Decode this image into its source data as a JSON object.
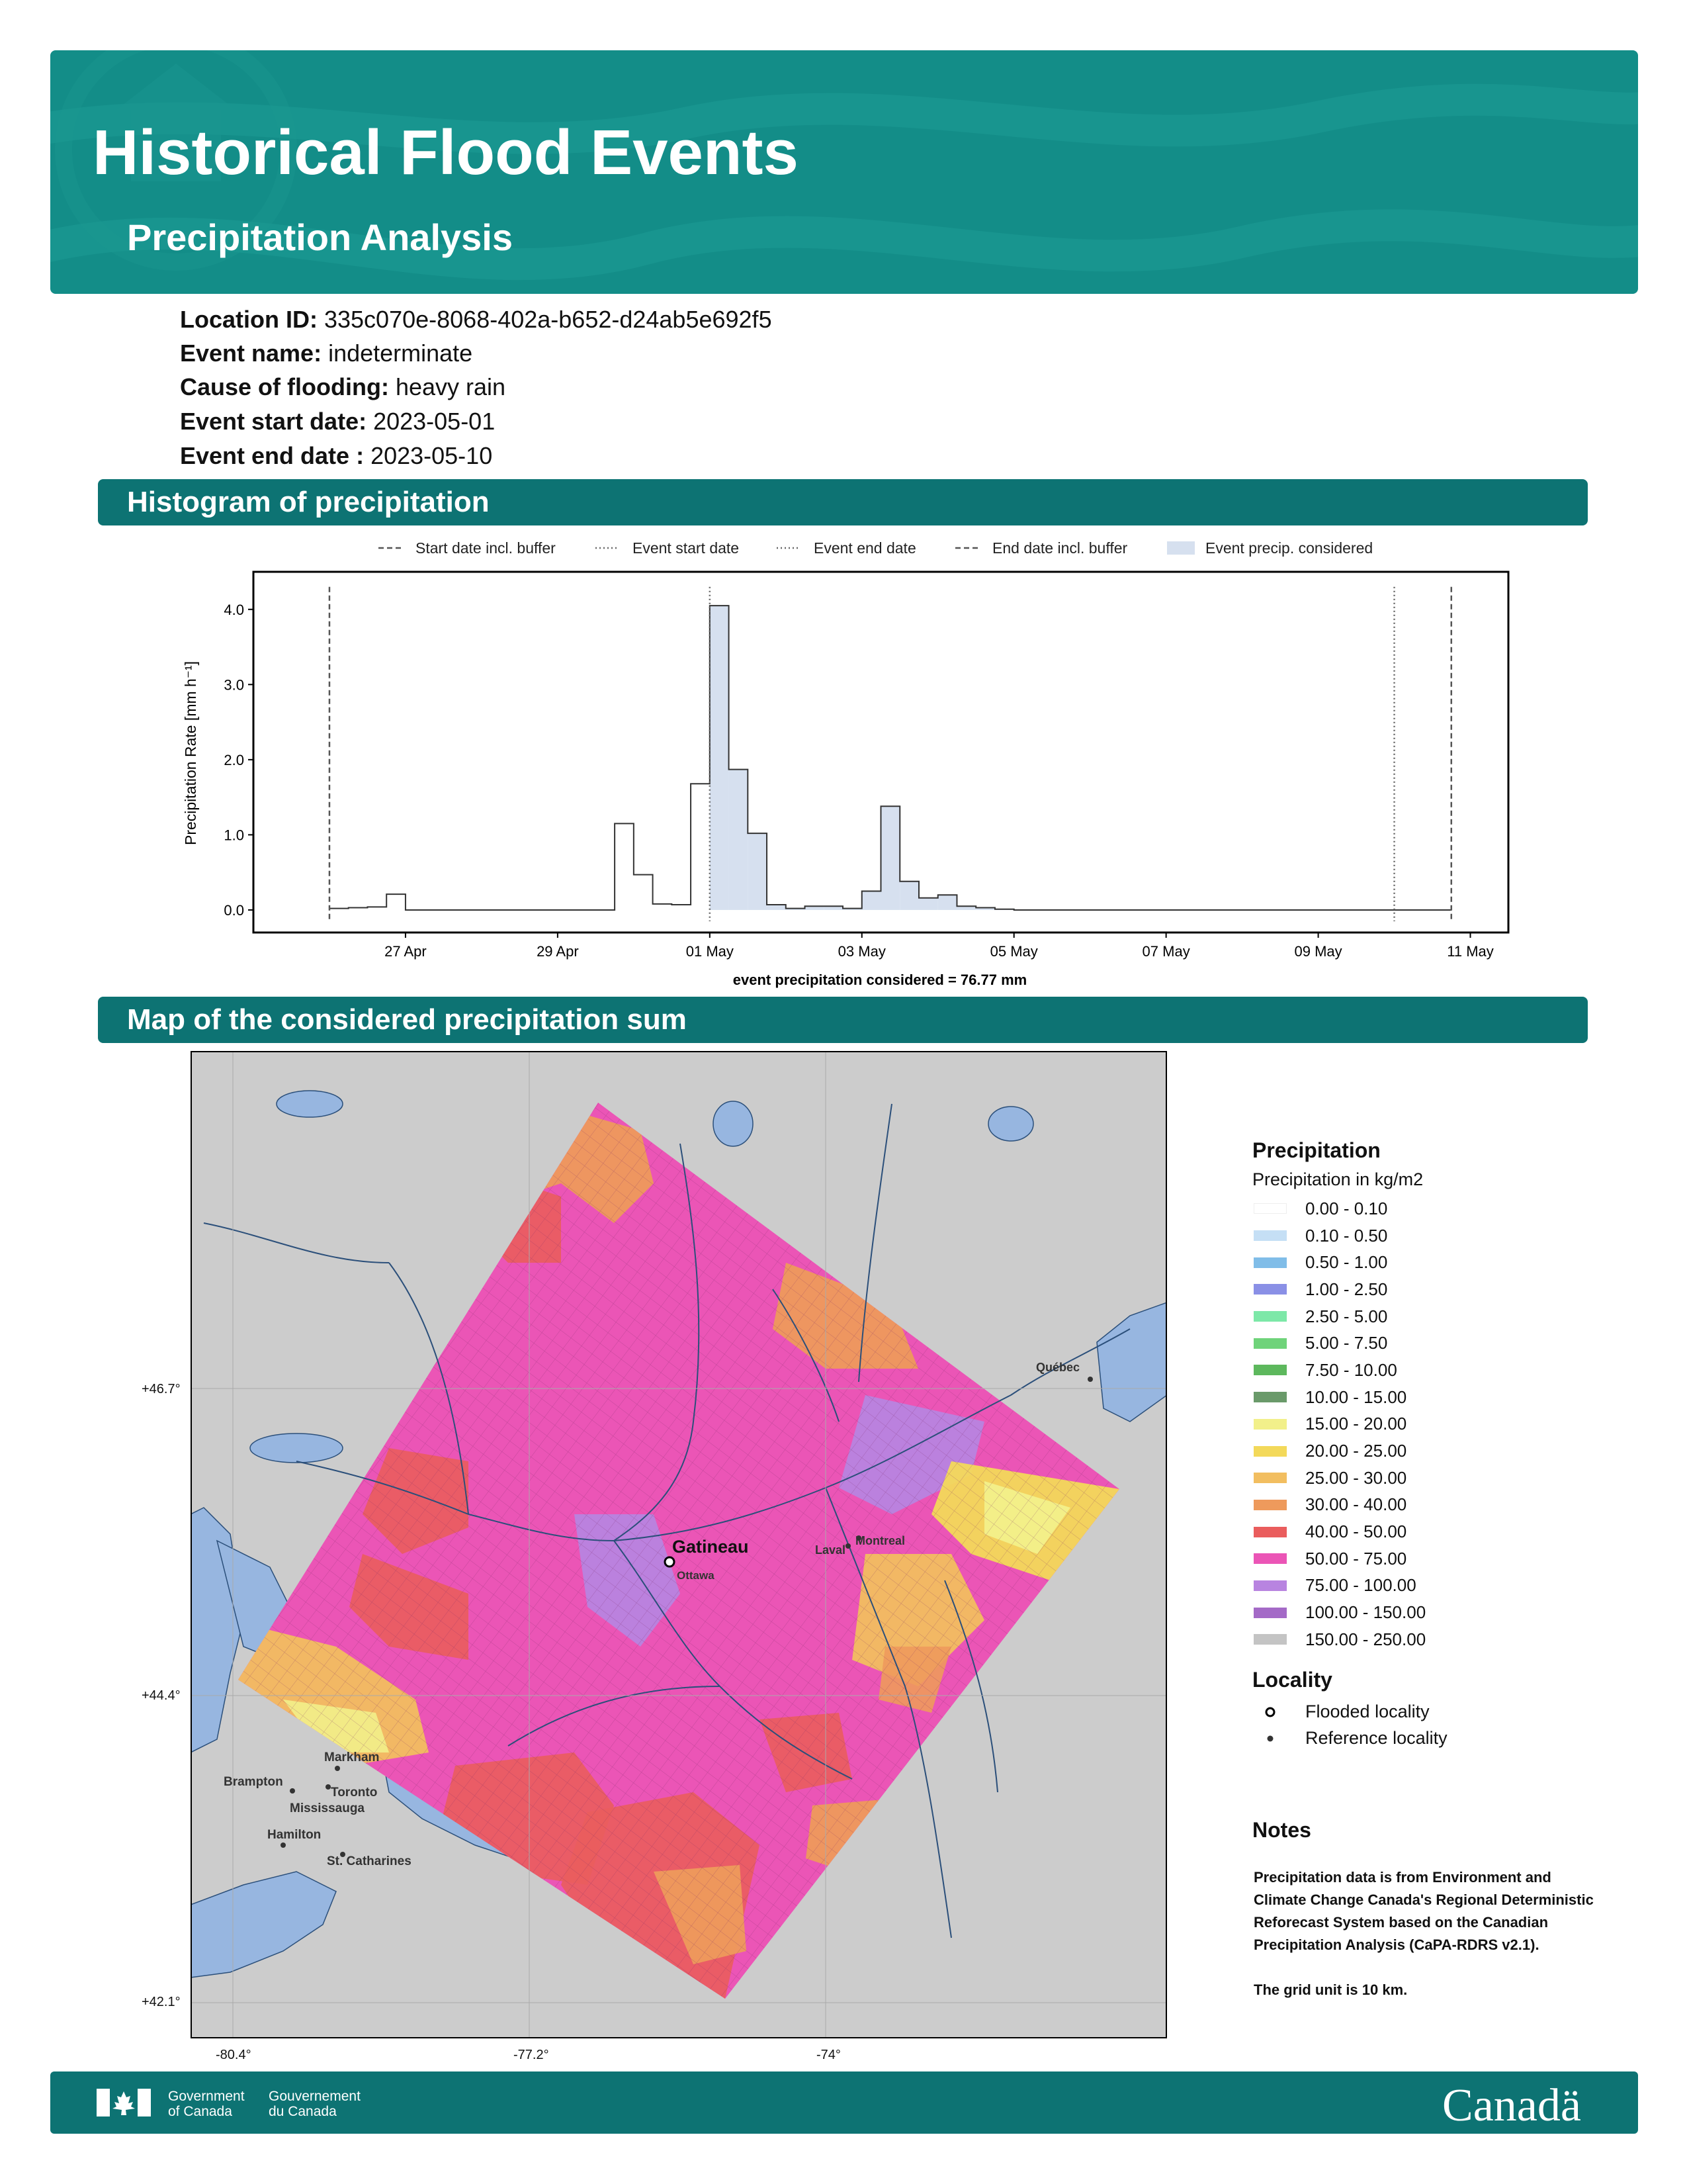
{
  "header": {
    "title": "Historical Flood Events",
    "subtitle": "Precipitation Analysis"
  },
  "info": {
    "location_id_label": "Location ID:",
    "location_id": "335c070e-8068-402a-b652-d24ab5e692f5",
    "event_name_label": "Event name:",
    "event_name": "indeterminate",
    "cause_label": "Cause of flooding:",
    "cause": "heavy rain",
    "start_label": "Event start date:",
    "start": "2023-05-01",
    "end_label": "Event end date :",
    "end": "2023-05-10"
  },
  "sections": {
    "histogram": "Histogram of precipitation",
    "map": "Map of the considered precipitation sum"
  },
  "chart_data": {
    "type": "bar",
    "ylabel": "Precipitation Rate [mm h⁻¹]",
    "xlabel": "event precipitation considered = 76.77 mm",
    "yticks": [
      "0.0",
      "1.0",
      "2.0",
      "3.0",
      "4.0"
    ],
    "ylim": [
      -0.3,
      4.5
    ],
    "xlim": [
      "2023-04-25",
      "2023-05-11 12:00"
    ],
    "xticks": [
      "27 Apr",
      "29 Apr",
      "01 May",
      "03 May",
      "05 May",
      "07 May",
      "09 May",
      "11 May"
    ],
    "xtick_dates": [
      "2023-04-27",
      "2023-04-29",
      "2023-05-01",
      "2023-05-03",
      "2023-05-05",
      "2023-05-07",
      "2023-05-09",
      "2023-05-11"
    ],
    "legend": [
      "Start date incl. buffer",
      "Event start date",
      "Event end date",
      "End date incl. buffer",
      "Event precip. considered"
    ],
    "vlines": {
      "start_buffer": "2023-04-26",
      "event_start": "2023-05-01",
      "event_end": "2023-05-10",
      "end_buffer": "2023-05-10 18:00"
    },
    "bin_hours": 6,
    "bins": [
      {
        "t": "2023-04-26 00:00",
        "v": 0.02
      },
      {
        "t": "2023-04-26 06:00",
        "v": 0.03
      },
      {
        "t": "2023-04-26 12:00",
        "v": 0.04
      },
      {
        "t": "2023-04-26 18:00",
        "v": 0.21
      },
      {
        "t": "2023-04-27 00:00",
        "v": 0.0
      },
      {
        "t": "2023-04-27 06:00",
        "v": 0.0
      },
      {
        "t": "2023-04-27 12:00",
        "v": 0.0
      },
      {
        "t": "2023-04-27 18:00",
        "v": 0.0
      },
      {
        "t": "2023-04-28 00:00",
        "v": 0.0
      },
      {
        "t": "2023-04-28 06:00",
        "v": 0.0
      },
      {
        "t": "2023-04-28 12:00",
        "v": 0.0
      },
      {
        "t": "2023-04-28 18:00",
        "v": 0.0
      },
      {
        "t": "2023-04-29 00:00",
        "v": 0.0
      },
      {
        "t": "2023-04-29 06:00",
        "v": 0.0
      },
      {
        "t": "2023-04-29 12:00",
        "v": 0.0
      },
      {
        "t": "2023-04-29 18:00",
        "v": 1.15
      },
      {
        "t": "2023-04-30 00:00",
        "v": 0.47
      },
      {
        "t": "2023-04-30 06:00",
        "v": 0.08
      },
      {
        "t": "2023-04-30 12:00",
        "v": 0.07
      },
      {
        "t": "2023-04-30 18:00",
        "v": 1.68
      },
      {
        "t": "2023-05-01 00:00",
        "v": 4.05
      },
      {
        "t": "2023-05-01 06:00",
        "v": 1.87
      },
      {
        "t": "2023-05-01 12:00",
        "v": 1.02
      },
      {
        "t": "2023-05-01 18:00",
        "v": 0.07
      },
      {
        "t": "2023-05-02 00:00",
        "v": 0.02
      },
      {
        "t": "2023-05-02 06:00",
        "v": 0.05
      },
      {
        "t": "2023-05-02 12:00",
        "v": 0.05
      },
      {
        "t": "2023-05-02 18:00",
        "v": 0.02
      },
      {
        "t": "2023-05-03 00:00",
        "v": 0.25
      },
      {
        "t": "2023-05-03 06:00",
        "v": 1.38
      },
      {
        "t": "2023-05-03 12:00",
        "v": 0.38
      },
      {
        "t": "2023-05-03 18:00",
        "v": 0.16
      },
      {
        "t": "2023-05-04 00:00",
        "v": 0.2
      },
      {
        "t": "2023-05-04 06:00",
        "v": 0.05
      },
      {
        "t": "2023-05-04 12:00",
        "v": 0.03
      },
      {
        "t": "2023-05-04 18:00",
        "v": 0.01
      },
      {
        "t": "2023-05-05 00:00",
        "v": 0.0
      },
      {
        "t": "2023-05-05 06:00",
        "v": 0.0
      },
      {
        "t": "2023-05-05 12:00",
        "v": 0.0
      },
      {
        "t": "2023-05-05 18:00",
        "v": 0.0
      },
      {
        "t": "2023-05-06 00:00",
        "v": 0.0
      },
      {
        "t": "2023-05-06 06:00",
        "v": 0.0
      },
      {
        "t": "2023-05-06 12:00",
        "v": 0.0
      },
      {
        "t": "2023-05-06 18:00",
        "v": 0.0
      },
      {
        "t": "2023-05-07 00:00",
        "v": 0.0
      },
      {
        "t": "2023-05-07 06:00",
        "v": 0.0
      },
      {
        "t": "2023-05-07 12:00",
        "v": 0.0
      },
      {
        "t": "2023-05-07 18:00",
        "v": 0.0
      },
      {
        "t": "2023-05-08 00:00",
        "v": 0.0
      },
      {
        "t": "2023-05-08 06:00",
        "v": 0.0
      },
      {
        "t": "2023-05-08 12:00",
        "v": 0.0
      },
      {
        "t": "2023-05-08 18:00",
        "v": 0.0
      },
      {
        "t": "2023-05-09 00:00",
        "v": 0.0
      },
      {
        "t": "2023-05-09 06:00",
        "v": 0.0
      },
      {
        "t": "2023-05-09 12:00",
        "v": 0.0
      },
      {
        "t": "2023-05-09 18:00",
        "v": 0.0
      },
      {
        "t": "2023-05-10 00:00",
        "v": 0.0
      },
      {
        "t": "2023-05-10 06:00",
        "v": 0.0
      },
      {
        "t": "2023-05-10 12:00",
        "v": 0.0
      }
    ],
    "colors": {
      "considered_fill": "#d6e0ef",
      "step_line": "#333333"
    }
  },
  "map": {
    "lat_labels": [
      "+46.7°",
      "+44.4°",
      "+42.1°"
    ],
    "lon_labels": [
      "-80.4°",
      "-77.2°",
      "-74°"
    ],
    "flooded_locality": "Gatineau",
    "places": [
      "Ottawa",
      "Québec",
      "Laval",
      "Montreal",
      "Markham",
      "Brampton",
      "Toronto",
      "Mississauga",
      "Hamilton",
      "St. Catharines"
    ],
    "colors": {
      "land": "#cccccc",
      "water": "#97b6e0",
      "rivers": "#2b4f7a"
    }
  },
  "legend": {
    "title": "Precipitation",
    "subtitle": "Precipitation in kg/m2",
    "items": [
      {
        "label": "0.00 - 0.10",
        "color": "#ffffff"
      },
      {
        "label": "0.10 - 0.50",
        "color": "#c5dff5"
      },
      {
        "label": "0.50 - 1.00",
        "color": "#80bde8"
      },
      {
        "label": "1.00 - 2.50",
        "color": "#8a90e6"
      },
      {
        "label": "2.50 - 5.00",
        "color": "#7de8a8"
      },
      {
        "label": "5.00 - 7.50",
        "color": "#6fd37a"
      },
      {
        "label": "7.50 - 10.00",
        "color": "#5db85d"
      },
      {
        "label": "10.00 - 15.00",
        "color": "#6a9a6a"
      },
      {
        "label": "15.00 - 20.00",
        "color": "#f2f08a"
      },
      {
        "label": "20.00 - 25.00",
        "color": "#f3d95a"
      },
      {
        "label": "25.00 - 30.00",
        "color": "#f2be60"
      },
      {
        "label": "30.00 - 40.00",
        "color": "#ee9a5c"
      },
      {
        "label": "40.00 - 50.00",
        "color": "#ea5d5d"
      },
      {
        "label": "50.00 - 75.00",
        "color": "#eb55b6"
      },
      {
        "label": "75.00 - 100.00",
        "color": "#b884e0"
      },
      {
        "label": "100.00 - 150.00",
        "color": "#a46ac7"
      },
      {
        "label": "150.00 - 250.00",
        "color": "#c4c4c4"
      }
    ],
    "locality_title": "Locality",
    "flooded_label": "Flooded locality",
    "reference_label": "Reference locality"
  },
  "notes": {
    "title": "Notes",
    "paragraph1": "Precipitation data is from Environment and Climate Change Canada's Regional Deterministic Reforecast System based on the Canadian Precipitation Analysis (CaPA-RDRS v2.1).",
    "paragraph2": "The grid unit is 10 km."
  },
  "footer": {
    "gov_en_1": "Government",
    "gov_en_2": "of Canada",
    "gov_fr_1": "Gouvernement",
    "gov_fr_2": "du Canada",
    "wordmark": "Canadä"
  }
}
